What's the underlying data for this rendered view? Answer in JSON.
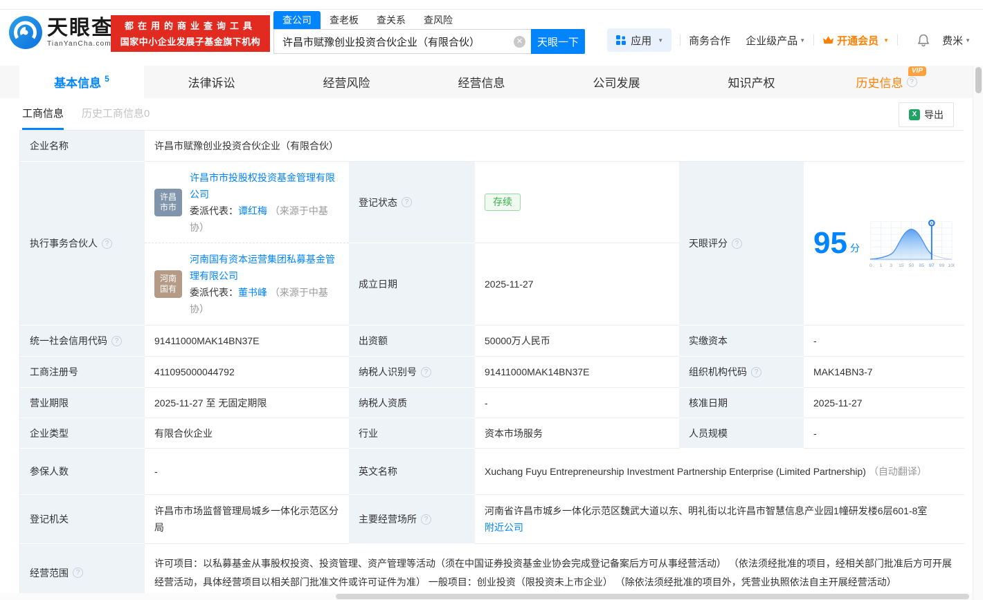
{
  "colors": {
    "primary_blue": "#0084ff",
    "banner_red": "#e12b21",
    "vip_orange": "#ff8000",
    "status_green": "#3cb14a",
    "label_bg": "#eef3f8",
    "avatar1": "#8095ab",
    "avatar2": "#b59b85"
  },
  "icons": {
    "help": "?",
    "clear": "✕",
    "caret": "▼",
    "excel": "X"
  },
  "header": {
    "logo_cn": "天眼查",
    "logo_en": "TianYanCha.com",
    "banner_line1": "都在用的商业查询工具",
    "banner_line2": "国家中小企业发展子基金旗下机构",
    "search_tabs": [
      {
        "label": "查公司"
      },
      {
        "label": "查老板"
      },
      {
        "label": "查关系"
      },
      {
        "label": "查风险"
      }
    ],
    "search_value": "许昌市赋豫创业投资合伙企业（有限合伙）",
    "search_button": "天眼一下",
    "nav_apps": "应用",
    "nav_cooperation": "商务合作",
    "nav_enterprise": "企业级产品",
    "nav_vip": "开通会员",
    "nav_user": "费米"
  },
  "tabs": {
    "basic": "基本信息",
    "basic_count": "5",
    "legal": "法律诉讼",
    "risk": "经营风险",
    "operation": "经营信息",
    "development": "公司发展",
    "ip": "知识产权",
    "history": "历史信息",
    "history_vip": "VIP"
  },
  "subtabs": {
    "current": "工商信息",
    "history": "历史工商信息0",
    "export": "导出"
  },
  "company": {
    "name_label": "企业名称",
    "name": "许昌市赋豫创业投资合伙企业（有限合伙）"
  },
  "partners": {
    "label": "执行事务合伙人",
    "rep_prefix": "委派代表：",
    "source_note": "（来源于中基协）",
    "p1": {
      "avatar_line1": "许昌",
      "avatar_line2": "市市",
      "name": "许昌市市投股权投资基金管理有限公司",
      "rep": "谭红梅"
    },
    "p2": {
      "avatar_line1": "河南",
      "avatar_line2": "国有",
      "name": "河南国有资本运营集团私募基金管理有限公司",
      "rep": "董书峰"
    }
  },
  "status": {
    "label": "登记状态",
    "value": "存续"
  },
  "establish": {
    "label": "成立日期",
    "value": "2025-11-27"
  },
  "score": {
    "label": "天眼评分",
    "value": "95",
    "unit": "分"
  },
  "score_chart": {
    "type": "area",
    "ticks": [
      "0",
      "1",
      "3",
      "15",
      "50",
      "85",
      "97",
      "99",
      "100"
    ],
    "marker_tick": "97",
    "score_value": 95,
    "shape": "bell-curve peaking near 50, highlighted marker pin at 97"
  },
  "fields": {
    "credit_code": {
      "label": "统一社会信用代码",
      "value": "91411000MAK14BN37E"
    },
    "capital": {
      "label": "出资额",
      "value": "50000万人民币"
    },
    "paid_capital": {
      "label": "实缴资本",
      "value": "-"
    },
    "reg_number": {
      "label": "工商注册号",
      "value": "411095000044792"
    },
    "taxpayer_id": {
      "label": "纳税人识别号",
      "value": "91411000MAK14BN37E"
    },
    "org_code": {
      "label": "组织机构代码",
      "value": "MAK14BN3-7"
    },
    "business_term": {
      "label": "营业期限",
      "value": "2025-11-27 至 无固定期限"
    },
    "taxpayer_quality": {
      "label": "纳税人资质",
      "value": "-"
    },
    "approval_date": {
      "label": "核准日期",
      "value": "2025-11-27"
    },
    "company_type": {
      "label": "企业类型",
      "value": "有限合伙企业"
    },
    "industry": {
      "label": "行业",
      "value": "资本市场服务"
    },
    "staff_size": {
      "label": "人员规模",
      "value": "-"
    },
    "insured_count": {
      "label": "参保人数",
      "value": "-"
    },
    "english_name": {
      "label": "英文名称",
      "value": "Xuchang Fuyu Entrepreneurship Investment Partnership Enterprise (Limited Partnership)",
      "note": "（自动翻译）"
    },
    "registry": {
      "label": "登记机关",
      "value": "许昌市市场监督管理局城乡一体化示范区分局"
    },
    "address": {
      "label": "主要经营场所",
      "value": "河南省许昌市城乡一体化示范区魏武大道以东、明礼街以北许昌市智慧信息产业园1幢研发楼6层601-8室",
      "link": "附近公司"
    },
    "business_scope": {
      "label": "经营范围",
      "value": "许可项目：以私募基金从事股权投资、投资管理、资产管理等活动（须在中国证券投资基金业协会完成登记备案后方可从事经营活动） （依法须经批准的项目，经相关部门批准后方可开展经营活动，具体经营项目以相关部门批准文件或许可证件为准） 一般项目：创业投资（限投资未上市企业） （除依法须经批准的项目外，凭营业执照依法自主开展经营活动）"
    }
  }
}
